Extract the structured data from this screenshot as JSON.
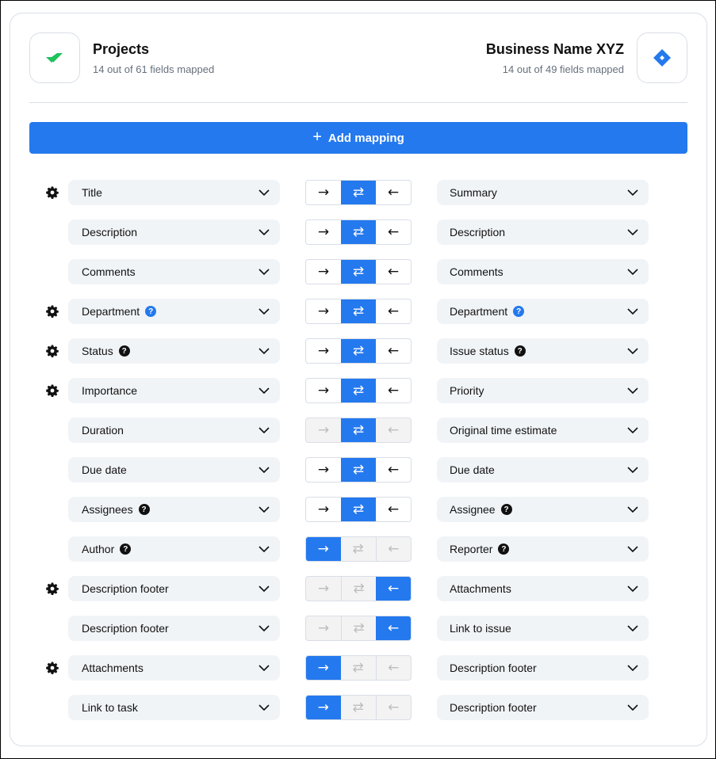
{
  "header": {
    "left_app": {
      "title": "Projects",
      "subtitle": "14 out of 61 fields mapped",
      "icon": "wrike-check-logo",
      "color": "#21c25e"
    },
    "right_app": {
      "title": "Business Name XYZ",
      "subtitle": "14 out of 49 fields mapped",
      "icon": "jira-diamond-logo",
      "color": "#2479ee"
    }
  },
  "add_mapping": {
    "label": "Add mapping",
    "icon": "plus-icon"
  },
  "colors": {
    "accent": "#2479ee",
    "select_bg": "#f1f4f7",
    "muted_arrow": "#bdbdbd"
  },
  "direction_icons": {
    "right": "→",
    "both": "⇄",
    "left": "←"
  },
  "help_glyph": "?",
  "rows": [
    {
      "gear": true,
      "left": {
        "label": "Title"
      },
      "right": {
        "label": "Summary"
      },
      "direction": "both",
      "disabled": false
    },
    {
      "gear": false,
      "left": {
        "label": "Description"
      },
      "right": {
        "label": "Description"
      },
      "direction": "both",
      "disabled": false
    },
    {
      "gear": false,
      "left": {
        "label": "Comments"
      },
      "right": {
        "label": "Comments"
      },
      "direction": "both",
      "disabled": false
    },
    {
      "gear": true,
      "left": {
        "label": "Department",
        "help": "blue"
      },
      "right": {
        "label": "Department",
        "help": "blue"
      },
      "direction": "both",
      "disabled": false
    },
    {
      "gear": true,
      "left": {
        "label": "Status",
        "help": "black"
      },
      "right": {
        "label": "Issue status",
        "help": "black"
      },
      "direction": "both",
      "disabled": false
    },
    {
      "gear": true,
      "left": {
        "label": "Importance"
      },
      "right": {
        "label": "Priority"
      },
      "direction": "both",
      "disabled": false
    },
    {
      "gear": false,
      "left": {
        "label": "Duration"
      },
      "right": {
        "label": "Original time estimate"
      },
      "direction": "both",
      "disabled": true
    },
    {
      "gear": false,
      "left": {
        "label": "Due date"
      },
      "right": {
        "label": "Due date"
      },
      "direction": "both",
      "disabled": false
    },
    {
      "gear": false,
      "left": {
        "label": "Assignees",
        "help": "black"
      },
      "right": {
        "label": "Assignee",
        "help": "black"
      },
      "direction": "both",
      "disabled": false
    },
    {
      "gear": false,
      "left": {
        "label": "Author",
        "help": "black"
      },
      "right": {
        "label": "Reporter",
        "help": "black"
      },
      "direction": "right",
      "disabled": true
    },
    {
      "gear": true,
      "left": {
        "label": "Description footer"
      },
      "right": {
        "label": "Attachments"
      },
      "direction": "left",
      "disabled": true
    },
    {
      "gear": false,
      "left": {
        "label": "Description footer"
      },
      "right": {
        "label": "Link to issue"
      },
      "direction": "left",
      "disabled": true
    },
    {
      "gear": true,
      "left": {
        "label": "Attachments"
      },
      "right": {
        "label": "Description footer"
      },
      "direction": "right",
      "disabled": true
    },
    {
      "gear": false,
      "left": {
        "label": "Link to task"
      },
      "right": {
        "label": "Description footer"
      },
      "direction": "right",
      "disabled": true
    }
  ]
}
